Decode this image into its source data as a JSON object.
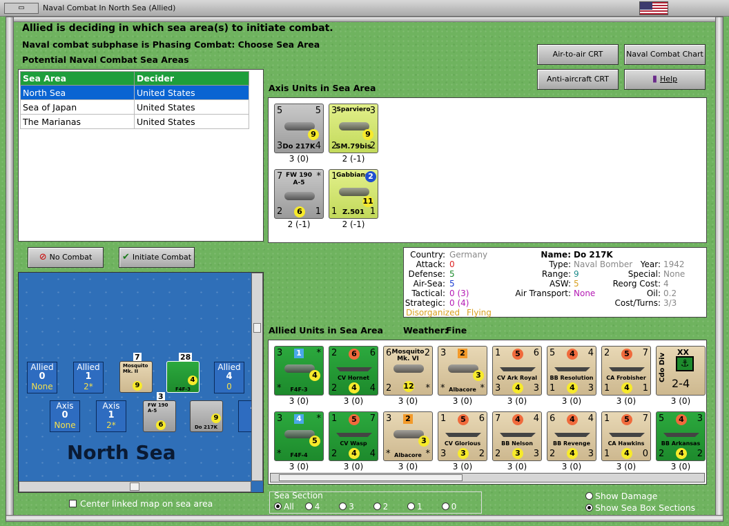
{
  "window": {
    "title": "Naval Combat In North Sea (Allied)"
  },
  "header": {
    "line1": "Allied is deciding in which sea area(s) to initiate combat.",
    "line2": "Naval combat subphase is Phasing Combat: Choose Sea Area",
    "line3": "Potential Naval Combat Sea Areas"
  },
  "buttons": {
    "air_to_air": "Air-to-air CRT",
    "naval_chart": "Naval Combat Chart",
    "anti_aircraft": "Anti-aircraft CRT",
    "help": "Help",
    "no_combat": "No Combat",
    "initiate_combat": "Initiate Combat"
  },
  "sea_table": {
    "headers": [
      "Sea Area",
      "Decider"
    ],
    "rows": [
      {
        "area": "North Sea",
        "decider": "United States",
        "selected": true
      },
      {
        "area": "Sea of Japan",
        "decider": "United States",
        "selected": false
      },
      {
        "area": "The Marianas",
        "decider": "United States",
        "selected": false
      }
    ]
  },
  "axis_panel": {
    "title": "Axis Units in Sea Area",
    "units": [
      {
        "name": "Do 217K",
        "tl": "5",
        "tr": "5",
        "bl": "3",
        "br": "4",
        "circle": "9",
        "sub": "3 (0)",
        "color": "gray"
      },
      {
        "name": "SM.79bis",
        "title": "Sparviero",
        "tl": "3",
        "tr": "3",
        "bl": "2",
        "br": "2",
        "circle": "9",
        "sub": "2 (-1)",
        "color": "yellowgreen"
      },
      {
        "name": "FW 190",
        "title2": "A-5",
        "tl": "7",
        "tr": "*",
        "bl": "2",
        "br": "1",
        "circle": "6",
        "sub": "2 (-1)",
        "color": "gray"
      },
      {
        "name": "Z.501",
        "title": "Gabbiano",
        "tl": "1",
        "tr": "2",
        "bl": "1",
        "br": "1",
        "circle": "11",
        "sub": "2 (-1)",
        "color": "yellowgreen"
      }
    ]
  },
  "info": {
    "country_label": "Country:",
    "country": "Germany",
    "attack_label": "Attack:",
    "attack": "0",
    "defense_label": "Defense:",
    "defense": "5",
    "airsea_label": "Air-Sea:",
    "airsea": "5",
    "tactical_label": "Tactical:",
    "tactical": "0 (3)",
    "strategic_label": "Strategic:",
    "strategic": "0 (4)",
    "status_1": "Disorganized",
    "status_2": "Flying",
    "name_label": "Name:",
    "name": "Do 217K",
    "type_label": "Type:",
    "type": "Naval Bomber",
    "year_label": "Year:",
    "year": "1942",
    "range_label": "Range:",
    "range": "9",
    "special_label": "Special:",
    "special": "None",
    "asw_label": "ASW:",
    "asw": "5",
    "reorg_label": "Reorg Cost:",
    "reorg": "4",
    "air_transport_label": "Air Transport:",
    "air_transport": "None",
    "oil_label": "Oil:",
    "oil": "0.2",
    "cost_label": "Cost/Turns:",
    "cost": "3/3"
  },
  "allied_panel": {
    "title": "Allied Units in Sea Area",
    "weather_label": "Weather:",
    "weather": "Fine",
    "row1": [
      {
        "name": "F4F-3",
        "tl": "3",
        "tr": "*",
        "bl": "*",
        "br": "",
        "circle": "4",
        "badge": "1",
        "sub": "3 (0)",
        "color": "green"
      },
      {
        "name": "CV Hornet",
        "tl": "2",
        "tr": "6",
        "bl": "2",
        "br": "4",
        "circle": "4",
        "ocircle": "6",
        "sub": "3 (0)",
        "color": "green"
      },
      {
        "name": "Mosquito",
        "title2": "Mk. VI",
        "tl": "6",
        "tr": "2",
        "bl": "2",
        "br": "*",
        "circle": "12",
        "sub": "3 (0)",
        "color": "tan"
      },
      {
        "name": "Albacore",
        "tl": "3",
        "tr": "",
        "bl": "*",
        "br": "*",
        "circle": "3",
        "badge": "2",
        "sub": "3 (0)",
        "color": "tan"
      },
      {
        "name": "CV Ark Royal",
        "tl": "1",
        "tr": "6",
        "bl": "3",
        "br": "3",
        "circle": "4",
        "ocircle": "5",
        "sub": "3 (0)",
        "color": "tan"
      },
      {
        "name": "BB Resolution",
        "tl": "5",
        "tr": "4",
        "bl": "1",
        "br": "3",
        "circle": "4",
        "ocircle": "4",
        "sub": "3 (0)",
        "color": "tan"
      },
      {
        "name": "CA Frobisher",
        "tl": "2",
        "tr": "7",
        "bl": "1",
        "br": "1",
        "circle": "4",
        "ocircle": "5",
        "sub": "3 (0)",
        "color": "tan"
      },
      {
        "name": "Cdo Div",
        "title": "XX",
        "big": "2-4",
        "sub": "3 (0)",
        "color": "tan"
      }
    ],
    "row2": [
      {
        "name": "F4F-4",
        "tl": "3",
        "tr": "*",
        "bl": "*",
        "br": "",
        "circle": "5",
        "badge": "4",
        "sub": "3 (0)",
        "color": "green"
      },
      {
        "name": "CV Wasp",
        "tl": "1",
        "tr": "7",
        "bl": "2",
        "br": "4",
        "circle": "4",
        "ocircle": "5",
        "sub": "3 (0)",
        "color": "green"
      },
      {
        "name": "Albacore",
        "tl": "3",
        "tr": "",
        "bl": "*",
        "br": "*",
        "circle": "3",
        "badge": "2",
        "sub": "3 (0)",
        "color": "tan"
      },
      {
        "name": "CV Glorious",
        "tl": "1",
        "tr": "6",
        "bl": "3",
        "br": "2",
        "circle": "3",
        "ocircle": "5",
        "sub": "3 (0)",
        "color": "tan"
      },
      {
        "name": "BB Nelson",
        "tl": "7",
        "tr": "4",
        "bl": "2",
        "br": "3",
        "circle": "3",
        "ocircle": "4",
        "sub": "3 (0)",
        "color": "tan"
      },
      {
        "name": "BB Revenge",
        "tl": "6",
        "tr": "4",
        "bl": "2",
        "br": "3",
        "circle": "4",
        "ocircle": "4",
        "sub": "3 (0)",
        "color": "tan"
      },
      {
        "name": "CA Hawkins",
        "tl": "1",
        "tr": "7",
        "bl": "1",
        "br": "0",
        "circle": "4",
        "ocircle": "5",
        "sub": "3 (0)",
        "color": "tan"
      },
      {
        "name": "BB Arkansas",
        "tl": "5",
        "tr": "3",
        "bl": "2",
        "br": "2",
        "circle": "4",
        "ocircle": "4",
        "sub": "3 (0)",
        "color": "green"
      }
    ]
  },
  "map": {
    "sea_name": "North Sea",
    "allied_left": {
      "label": "Allied",
      "num": "0",
      "sub": "None"
    },
    "allied_mid": {
      "label": "Allied",
      "num": "1",
      "sub": "2*"
    },
    "allied_right": {
      "label": "Allied",
      "num": "4",
      "sub": "0"
    },
    "axis_left": {
      "label": "Axis",
      "num": "0",
      "sub": "None"
    },
    "axis_mid": {
      "label": "Axis",
      "num": "1",
      "sub": "2*"
    },
    "axis_right": {
      "label": "A"
    },
    "stack1_count": "7",
    "stack2_count": "28",
    "stack3_count": "3",
    "c1": {
      "name": "Mosquito Mk. II",
      "circle": "9"
    },
    "c2": {
      "name": "F4F-3",
      "circle": "4"
    },
    "c3": {
      "name": "FW 190 A-5",
      "circle": "6"
    },
    "c4": {
      "name": "Do 217K",
      "circle": "9"
    }
  },
  "footer": {
    "center_map": "Center linked map on sea area",
    "section_title": "Sea Section",
    "sections": [
      "All",
      "4",
      "3",
      "2",
      "1",
      "0"
    ],
    "show_damage": "Show Damage",
    "show_sea_box": "Show Sea Box Sections"
  },
  "colors": {
    "table_header": "#1e9e3c",
    "selection": "#0a64d2",
    "sea": "#2f6fb8",
    "green_unit": "#2ca93e",
    "tan_unit": "#d8c49c"
  }
}
